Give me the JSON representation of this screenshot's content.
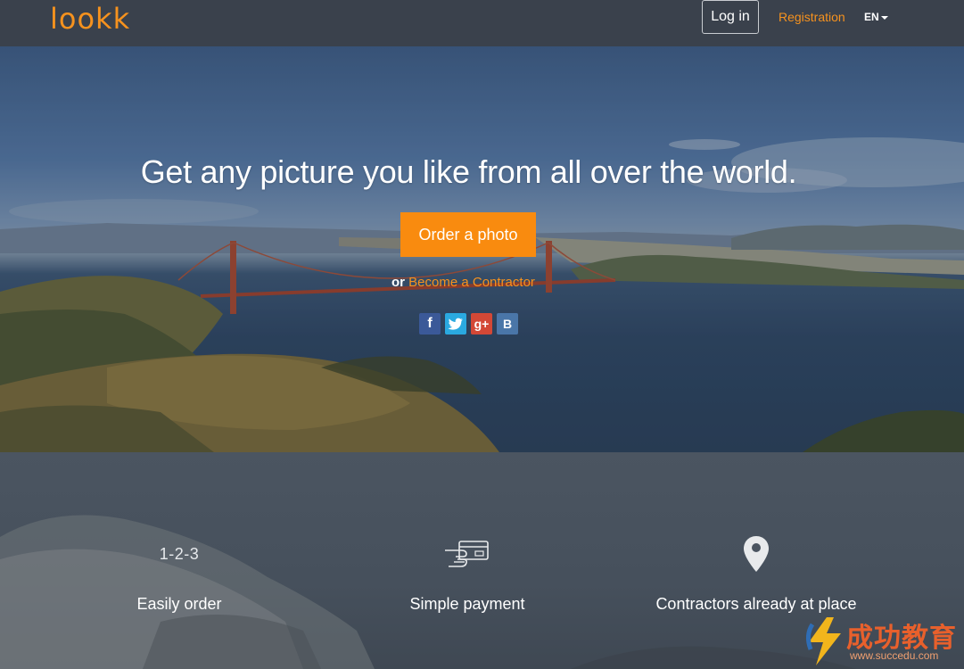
{
  "nav": {
    "logo": "lookk",
    "login_label": "Log in",
    "registration_label": "Registration",
    "language": "EN"
  },
  "hero": {
    "headline": "Get any picture you like from all over the world.",
    "order_button": "Order a photo",
    "or_text": "or",
    "contractor_link": "Become a Contractor",
    "social": {
      "facebook": "f",
      "twitter": "t",
      "google_plus": "g+",
      "vkontakte": "B"
    }
  },
  "features": [
    {
      "icon": "1-2-3",
      "label": "Easily order"
    },
    {
      "icon": "card-hand-icon",
      "label": "Simple payment"
    },
    {
      "icon": "map-pin-icon",
      "label": "Contractors already at place"
    }
  ],
  "watermark": {
    "text": "成功教育",
    "url": "www.succedu.com"
  },
  "colors": {
    "brand_orange": "#f98b0f",
    "nav_bg": "#3a414c"
  }
}
